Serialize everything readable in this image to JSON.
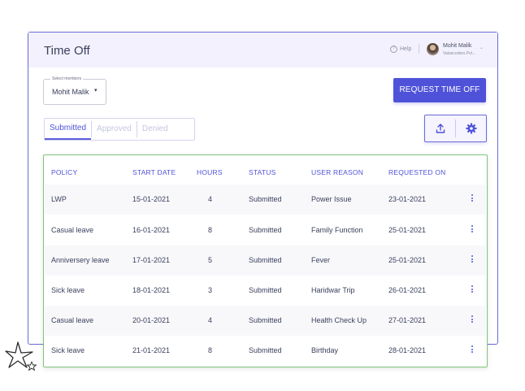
{
  "header": {
    "title": "Time Off",
    "help_label": "Help",
    "help_icon": "question-circle-icon",
    "user_name": "Mohit Malik",
    "user_company": "Valuecoders Pvt..."
  },
  "members_select": {
    "label": "Select members",
    "value": "Mohit Malik"
  },
  "request_button": {
    "label": "REQUEST TIME OFF"
  },
  "tabs": [
    {
      "label": "Submitted",
      "active": true
    },
    {
      "label": "Approved",
      "active": false
    },
    {
      "label": "Denied",
      "active": false
    }
  ],
  "toolbar_icons": [
    "upload-icon",
    "gear-icon"
  ],
  "colors": {
    "accent": "#4f52d9",
    "table_border": "#7fc47a",
    "header_bg": "#f2f1fd"
  },
  "table": {
    "columns": [
      "POLICY",
      "START DATE",
      "HOURS",
      "STATUS",
      "USER REASON",
      "REQUESTED ON"
    ],
    "rows": [
      [
        "LWP",
        "15-01-2021",
        "4",
        "Submitted",
        "Power Issue",
        "23-01-2021"
      ],
      [
        "Casual leave",
        "16-01-2021",
        "8",
        "Submitted",
        "Family Function",
        "25-01-2021"
      ],
      [
        "Anniversery leave",
        "17-01-2021",
        "5",
        "Submitted",
        "Fever",
        "25-01-2021"
      ],
      [
        "Sick leave",
        "18-01-2021",
        "3",
        "Submitted",
        "Haridwar Trip",
        "26-01-2021"
      ],
      [
        "Casual leave",
        "20-01-2021",
        "4",
        "Submitted",
        "Health Check Up",
        "27-01-2021"
      ],
      [
        "Sick leave",
        "21-01-2021",
        "8",
        "Submitted",
        "Birthday",
        "28-01-2021"
      ]
    ]
  }
}
